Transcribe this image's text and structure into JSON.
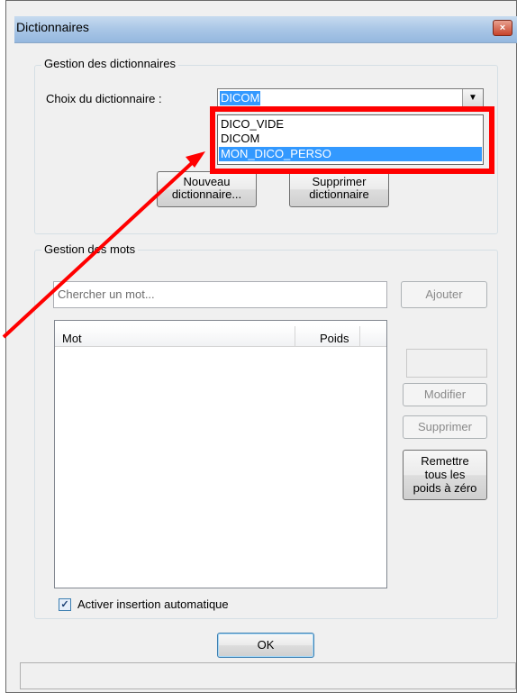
{
  "window": {
    "title": "Dictionnaires",
    "close_glyph": "×"
  },
  "dict_group": {
    "title": "Gestion des dictionnaires",
    "choice_label": "Choix du dictionnaire :",
    "selected_value": "DICOM",
    "options": [
      "DICO_VIDE",
      "DICOM",
      "MON_DICO_PERSO"
    ],
    "new_button_line1": "Nouveau",
    "new_button_line2": "dictionnaire...",
    "delete_button_line1": "Supprimer",
    "delete_button_line2": "dictionnaire"
  },
  "words_group": {
    "title": "Gestion des mots",
    "search_placeholder": "Chercher un mot...",
    "add_button": "Ajouter",
    "columns": [
      "Mot",
      "Poids"
    ],
    "modify_button": "Modifier",
    "delete_button": "Supprimer",
    "reset_line1": "Remettre",
    "reset_line2": "tous les",
    "reset_line3": "poids à zéro",
    "auto_insert_label": "Activer insertion automatique",
    "auto_insert_checked": true
  },
  "ok_button": "OK",
  "colors": {
    "highlight_box": "#ff0000",
    "arrow": "#ff0000",
    "selection": "#3399ff"
  }
}
